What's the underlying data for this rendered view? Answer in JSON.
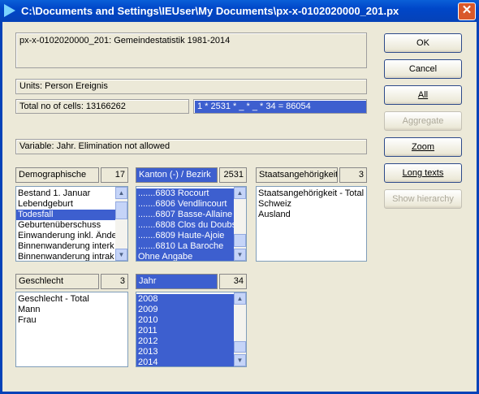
{
  "window": {
    "title": "C:\\Documents and Settings\\IEUser\\My Documents\\px-x-0102020000_201.px",
    "close": "✕"
  },
  "info": {
    "description": "px-x-0102020000_201: Gemeindestatistik 1981-2014",
    "units": "Units: Person Ereignis",
    "total_cells": "Total no of cells:  13166262",
    "formula": "1 * 2531 * _ * _ * 34  =  86054",
    "variable": "Variable: Jahr. Elimination not allowed"
  },
  "buttons": {
    "ok": "OK",
    "cancel": "Cancel",
    "all": "All",
    "aggregate": "Aggregate",
    "zoom": "Zoom",
    "long_texts": "Long texts",
    "show_hierarchy": "Show hierarchy"
  },
  "variables": {
    "demographische": {
      "header": "Demographische",
      "count": "17",
      "items": [
        "Bestand 1. Januar",
        "Lebendgeburt",
        "Todesfall",
        "Geburtenüberschuss",
        "Einwanderung inkl. Änderu",
        "Binnenwanderung interk",
        "Binnenwanderung intrak"
      ],
      "selected": [
        2
      ]
    },
    "kanton": {
      "header": "Kanton (-) / Bezirk",
      "count": "2531",
      "items": [
        ".......6803 Rocourt",
        ".......6806 Vendlincourt",
        ".......6807 Basse-Allaine",
        ".......6808 Clos du Doubs",
        ".......6809 Haute-Ajoie",
        ".......6810 La Baroche",
        "Ohne Angabe"
      ],
      "selected": [
        0,
        1,
        2,
        3,
        4,
        5,
        6
      ]
    },
    "staatsangehoerigkeit": {
      "header": "Staatsangehörigkeit",
      "count": "3",
      "items": [
        "Staatsangehörigkeit - Total",
        "Schweiz",
        "Ausland"
      ],
      "selected": []
    },
    "geschlecht": {
      "header": "Geschlecht",
      "count": "3",
      "items": [
        "Geschlecht - Total",
        "Mann",
        "Frau"
      ],
      "selected": []
    },
    "jahr": {
      "header": "Jahr",
      "count": "34",
      "items": [
        "2008",
        "2009",
        "2010",
        "2011",
        "2012",
        "2013",
        "2014"
      ],
      "selected": [
        0,
        1,
        2,
        3,
        4,
        5,
        6
      ]
    }
  },
  "colors": {
    "selection": "#3d5fcf",
    "title_bar": "#0542b8",
    "dialog": "#ece9d8"
  }
}
